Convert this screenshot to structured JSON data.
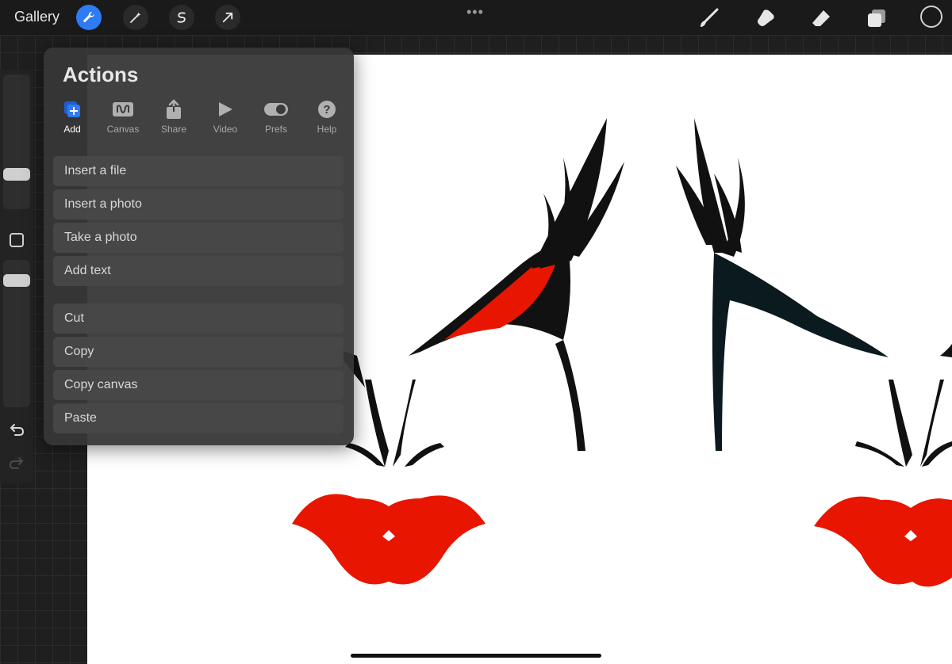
{
  "topbar": {
    "gallery_label": "Gallery",
    "left_tools": [
      {
        "icon": "wrench-icon",
        "active": true
      },
      {
        "icon": "magic-wand-icon",
        "active": false
      },
      {
        "icon": "selection-icon",
        "active": false
      },
      {
        "icon": "transform-arrow-icon",
        "active": false
      }
    ],
    "more_dots": "•••",
    "right_tools": [
      "brush-icon",
      "smudge-icon",
      "eraser-icon",
      "layers-icon",
      "color-circle-icon"
    ]
  },
  "actions": {
    "title": "Actions",
    "tabs": [
      {
        "label": "Add",
        "icon": "add-icon",
        "active": true
      },
      {
        "label": "Canvas",
        "icon": "canvas-icon",
        "active": false
      },
      {
        "label": "Share",
        "icon": "share-icon",
        "active": false
      },
      {
        "label": "Video",
        "icon": "video-play-icon",
        "active": false
      },
      {
        "label": "Prefs",
        "icon": "toggle-icon",
        "active": false
      },
      {
        "label": "Help",
        "icon": "help-icon",
        "active": false
      }
    ],
    "group1": [
      "Insert a file",
      "Insert a photo",
      "Take a photo",
      "Add text"
    ],
    "group2": [
      "Cut",
      "Copy",
      "Copy canvas",
      "Paste"
    ]
  },
  "colors": {
    "accent": "#2f7bf5",
    "artwork_red": "#e81500",
    "artwork_black": "#111111"
  }
}
